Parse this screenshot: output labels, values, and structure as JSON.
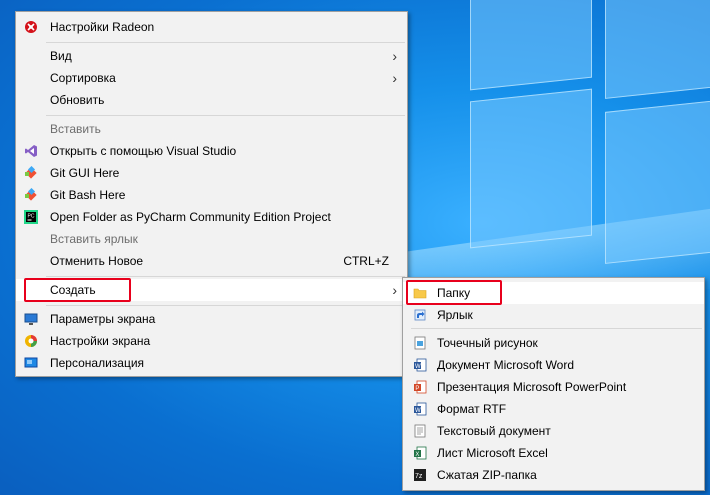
{
  "main_menu": {
    "items": [
      {
        "label": "Настройки Radeon",
        "icon": "radeon-icon"
      },
      {
        "label": "Вид",
        "submenu_arrow": "›"
      },
      {
        "label": "Сортировка",
        "submenu_arrow": "›"
      },
      {
        "label": "Обновить"
      },
      {
        "label": "Вставить",
        "disabled": true
      },
      {
        "label": "Открыть с помощью Visual Studio",
        "icon": "visual-studio-icon"
      },
      {
        "label": "Git GUI Here",
        "icon": "git-icon"
      },
      {
        "label": "Git Bash Here",
        "icon": "git-icon"
      },
      {
        "label": "Open Folder as PyCharm Community Edition Project",
        "icon": "pycharm-icon"
      },
      {
        "label": "Вставить ярлык",
        "disabled": true
      },
      {
        "label": "Отменить Новое",
        "shortcut": "CTRL+Z"
      },
      {
        "label": "Создать",
        "submenu_arrow": "›",
        "highlighted": true
      },
      {
        "label": "Параметры экрана",
        "icon": "display-settings-icon"
      },
      {
        "label": "Настройки экрана",
        "icon": "intel-graphics-icon"
      },
      {
        "label": "Персонализация",
        "icon": "personalization-icon"
      }
    ]
  },
  "sub_menu": {
    "items": [
      {
        "label": "Папку",
        "icon": "folder-icon",
        "highlighted": true
      },
      {
        "label": "Ярлык",
        "icon": "shortcut-icon"
      },
      {
        "label": "Точечный рисунок",
        "icon": "bitmap-icon"
      },
      {
        "label": "Документ Microsoft Word",
        "icon": "word-icon"
      },
      {
        "label": "Презентация Microsoft PowerPoint",
        "icon": "powerpoint-icon"
      },
      {
        "label": "Формат RTF",
        "icon": "rtf-icon"
      },
      {
        "label": "Текстовый документ",
        "icon": "text-document-icon"
      },
      {
        "label": "Лист Microsoft Excel",
        "icon": "excel-icon"
      },
      {
        "label": "Сжатая ZIP-папка",
        "icon": "zip-icon"
      }
    ]
  },
  "colors": {
    "highlight_border": "#e8001c",
    "menu_bg": "#f2f2f2",
    "desktop": "#1590ea"
  }
}
